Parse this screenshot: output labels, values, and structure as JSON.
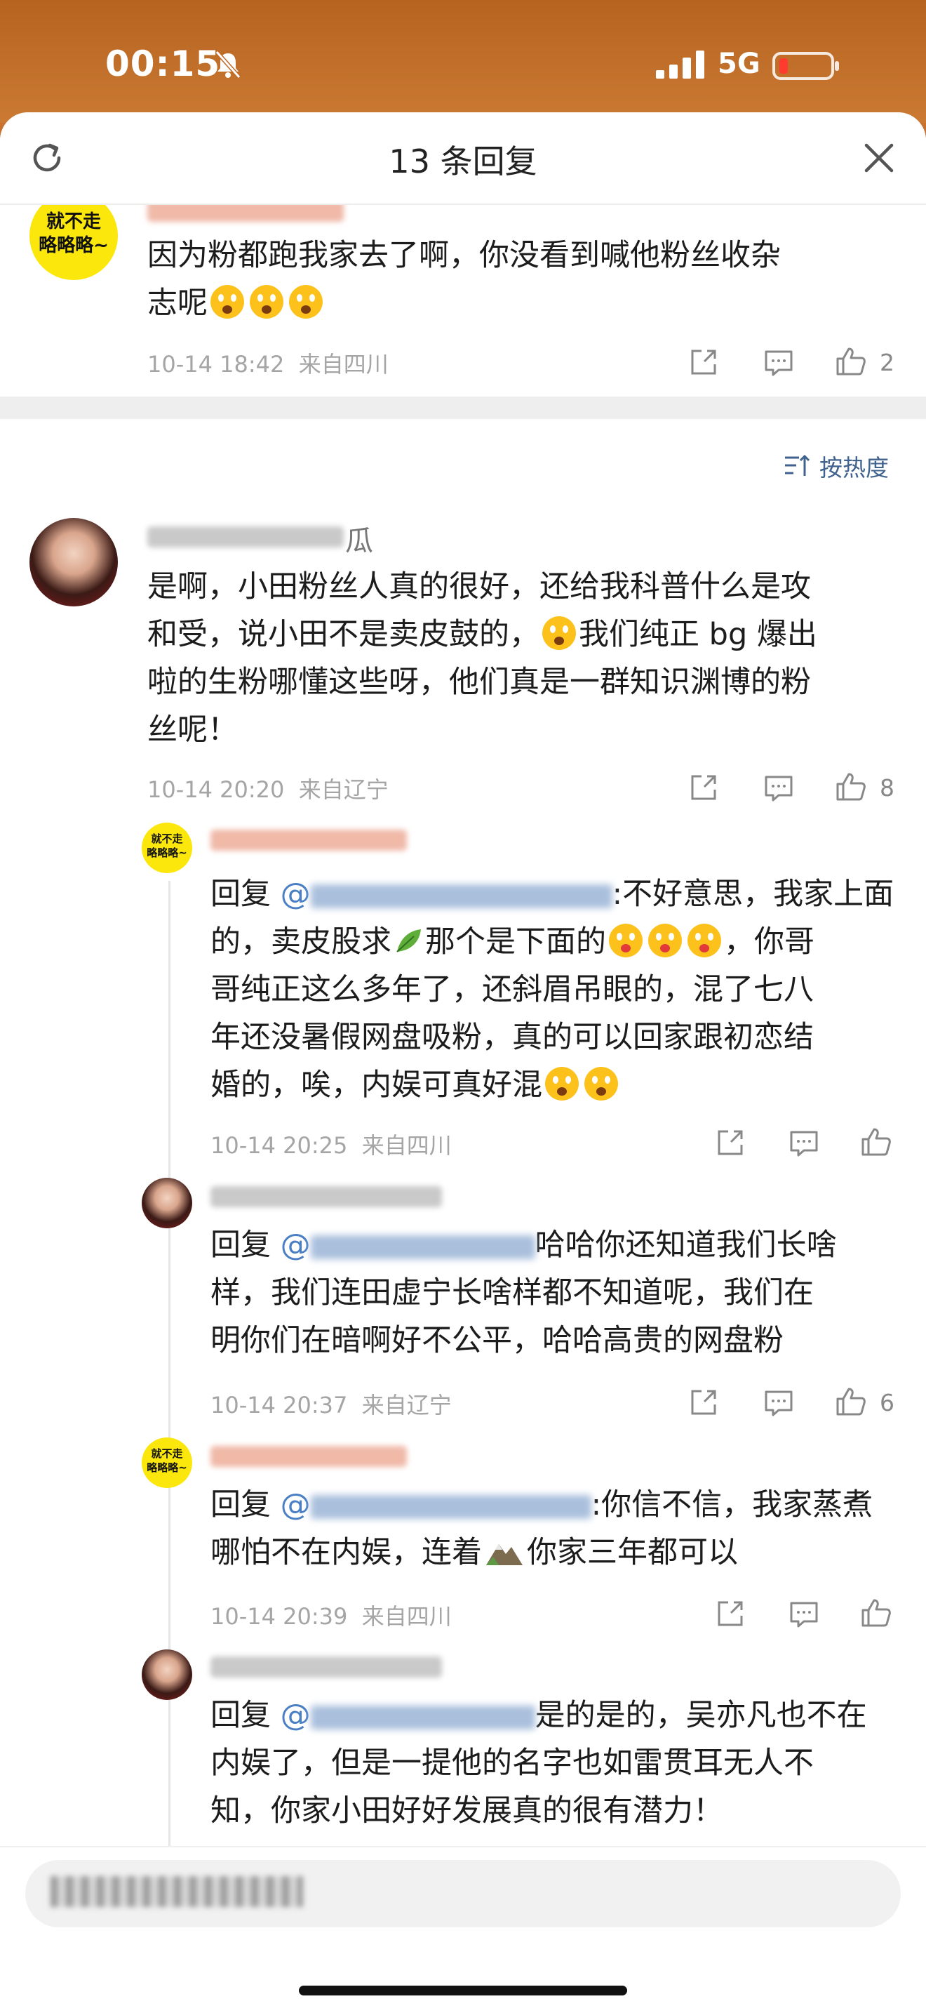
{
  "status": {
    "time": "00:15",
    "network": "5G"
  },
  "header": {
    "title": "13 条回复"
  },
  "top_comment": {
    "text": "因为粉都跑我家去了啊，你没看到喊他粉丝收杂",
    "text_line2": "志呢",
    "date": "10-14 18:42",
    "location": "来自四川",
    "likes": "2",
    "avatar_text_line1": "就不走",
    "avatar_text_line2": "略略略~"
  },
  "sort": {
    "label": "按热度"
  },
  "main_comment": {
    "name_tail": "瓜",
    "line1": "是啊，小田粉丝人真的很好，还给我科普什么是攻",
    "line2": "和受，说小田不是卖皮鼓的，",
    "line2b": "我们纯正 bg 爆出",
    "line3": "啦的生粉哪懂这些呀，他们真是一群知识渊博的粉",
    "line4": "丝呢！",
    "date": "10-14 20:20",
    "location": "来自辽宁",
    "likes": "8"
  },
  "replies": [
    {
      "prefix": "回复 ",
      "mention": "@",
      "line1": ":不好意思，我家上面",
      "line2a": "的，卖皮股求",
      "line2b": "那个是下面的",
      "line2c": "，你哥",
      "line3": "哥纯正这么多年了，还斜眉吊眼的，混了七八",
      "line4": "年还没暑假网盘吸粉，真的可以回家跟初恋结",
      "line5": "婚的，唉，内娱可真好混",
      "date": "10-14 20:25",
      "location": "来自四川"
    },
    {
      "prefix": "回复 ",
      "mention": "@",
      "line1": "哈哈你还知道我们长啥",
      "line2": "样，我们连田虚宁长啥样都不知道呢，我们在",
      "line3": "明你们在暗啊好不公平，哈哈高贵的网盘粉",
      "date": "10-14 20:37",
      "location": "来自辽宁",
      "likes": "6"
    },
    {
      "prefix": "回复 ",
      "mention": "@",
      "line1": ":你信不信，我家蒸煮",
      "line2a": "哪怕不在内娱，连着",
      "line2b": "你家三年都可以",
      "date": "10-14 20:39",
      "location": "来自四川"
    },
    {
      "prefix": "回复 ",
      "mention": "@",
      "line1": "是的是的，吴亦凡也不在",
      "line2": "内娱了，但是一提他的名字也如雷贯耳无人不",
      "line3": "知，你家小田好好发展真的很有潜力！"
    }
  ],
  "colors": {
    "accent": "#4a7fc4",
    "meta": "#a5a5a5",
    "avatar_yellow": "#fbe70b"
  }
}
